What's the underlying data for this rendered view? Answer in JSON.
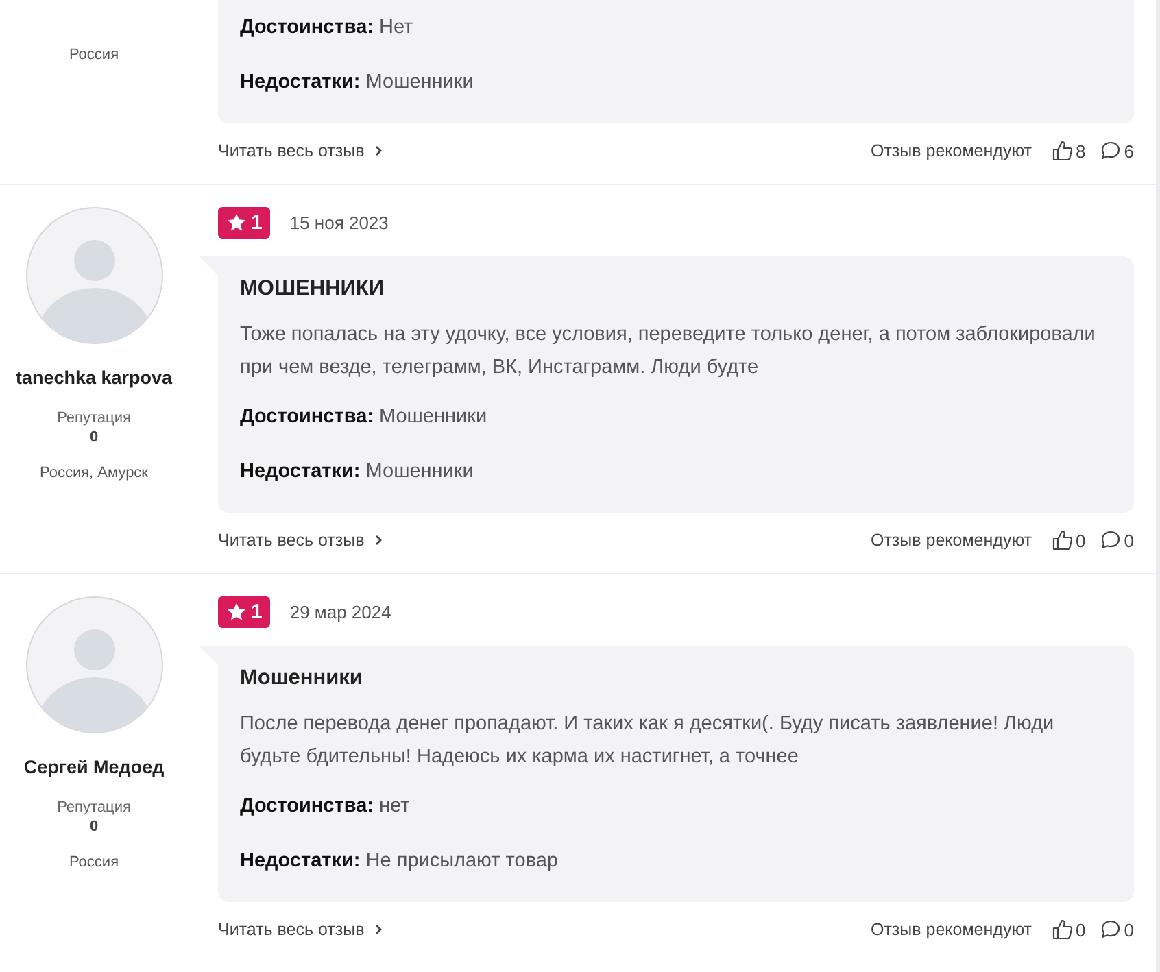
{
  "reviews": [
    {
      "author": {
        "location": "Россия"
      },
      "pros_label": "Достоинства:",
      "pros": "Нет",
      "cons_label": "Недостатки:",
      "cons": "Мошенники",
      "read_more": "Читать весь отзыв",
      "recommend_label": "Отзыв рекомендуют",
      "likes": "8",
      "comments": "6"
    },
    {
      "author": {
        "name": "tanechka karpova",
        "reputation_label": "Репутация",
        "reputation": "0",
        "location": "Россия, Амурск"
      },
      "rating": "1",
      "date": "15 ноя 2023",
      "title": "МОШЕННИКИ",
      "text": "Тоже попалась на эту удочку, все условия, переведите только денег, а потом заблокировали при чем везде, телеграмм, ВК, Инстаграмм. Люди будте",
      "pros_label": "Достоинства:",
      "pros": "Мошенники",
      "cons_label": "Недостатки:",
      "cons": "Мошенники",
      "read_more": "Читать весь отзыв",
      "recommend_label": "Отзыв рекомендуют",
      "likes": "0",
      "comments": "0"
    },
    {
      "author": {
        "name": "Сергей Медоед",
        "reputation_label": "Репутация",
        "reputation": "0",
        "location": "Россия"
      },
      "rating": "1",
      "date": "29 мар 2024",
      "title": "Мошенники",
      "text": "После перевода денег пропадают. И таких как я десятки(. Буду писать заявление! Люди будьте бдительны! Надеюсь их карма их настигнет, а точнее",
      "pros_label": "Достоинства:",
      "pros": "нет",
      "cons_label": "Недостатки:",
      "cons": "Не присылают товар",
      "read_more": "Читать весь отзыв",
      "recommend_label": "Отзыв рекомендуют",
      "likes": "0",
      "comments": "0"
    }
  ]
}
